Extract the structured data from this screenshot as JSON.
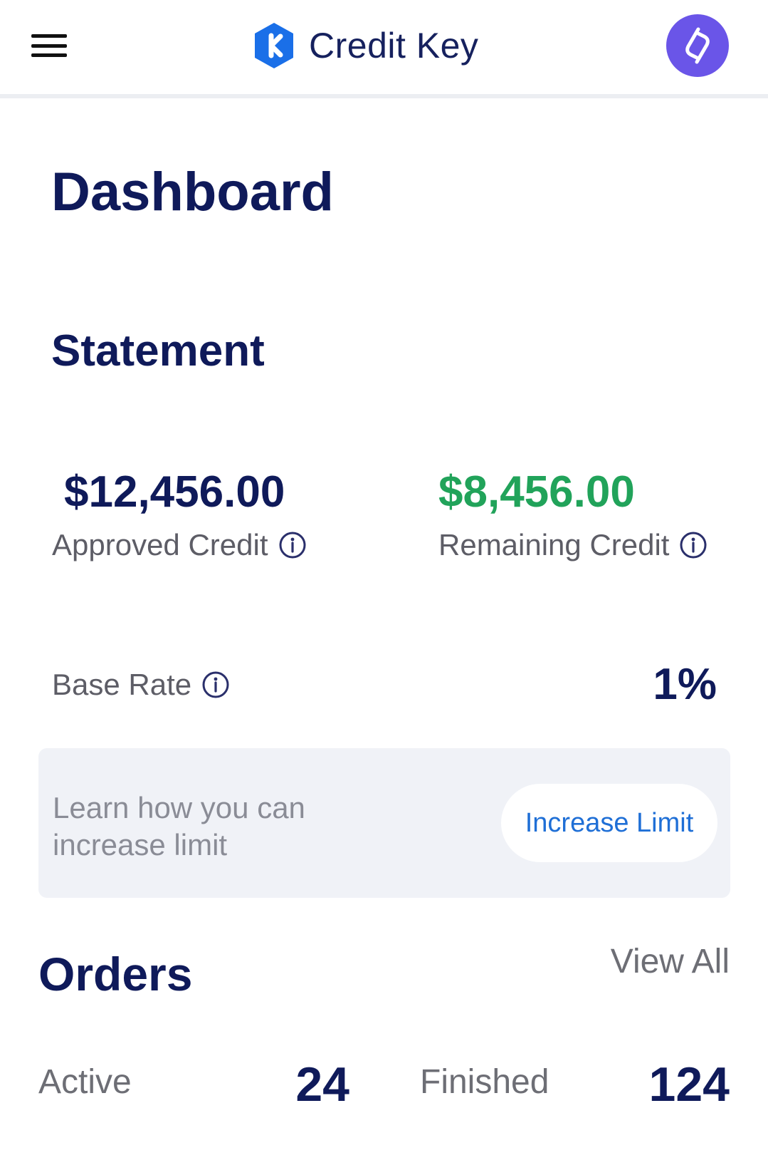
{
  "header": {
    "brand_name": "Credit Key",
    "menu_icon": "hamburger-menu-icon",
    "logo_icon": "credit-key-logo",
    "avatar_icon": "user-avatar-icon",
    "brand_color": "#1a6fe8",
    "avatar_color": "#6a55e8"
  },
  "page": {
    "title": "Dashboard"
  },
  "statement": {
    "title": "Statement",
    "approved_credit": {
      "amount": "$12,456.00",
      "label": "Approved Credit",
      "icon": "info-icon"
    },
    "remaining_credit": {
      "amount": "$8,456.00",
      "label": "Remaining Credit",
      "icon": "info-icon",
      "color": "#21a35a"
    },
    "base_rate": {
      "label": "Base Rate",
      "value": "1%",
      "icon": "info-icon"
    }
  },
  "limit_card": {
    "text": "Learn how you can increase limit",
    "button_label": "Increase Limit"
  },
  "orders": {
    "title": "Orders",
    "view_all_label": "View All",
    "active_label": "Active",
    "active_count": "24",
    "finished_label": "Finished",
    "finished_count": "124"
  }
}
